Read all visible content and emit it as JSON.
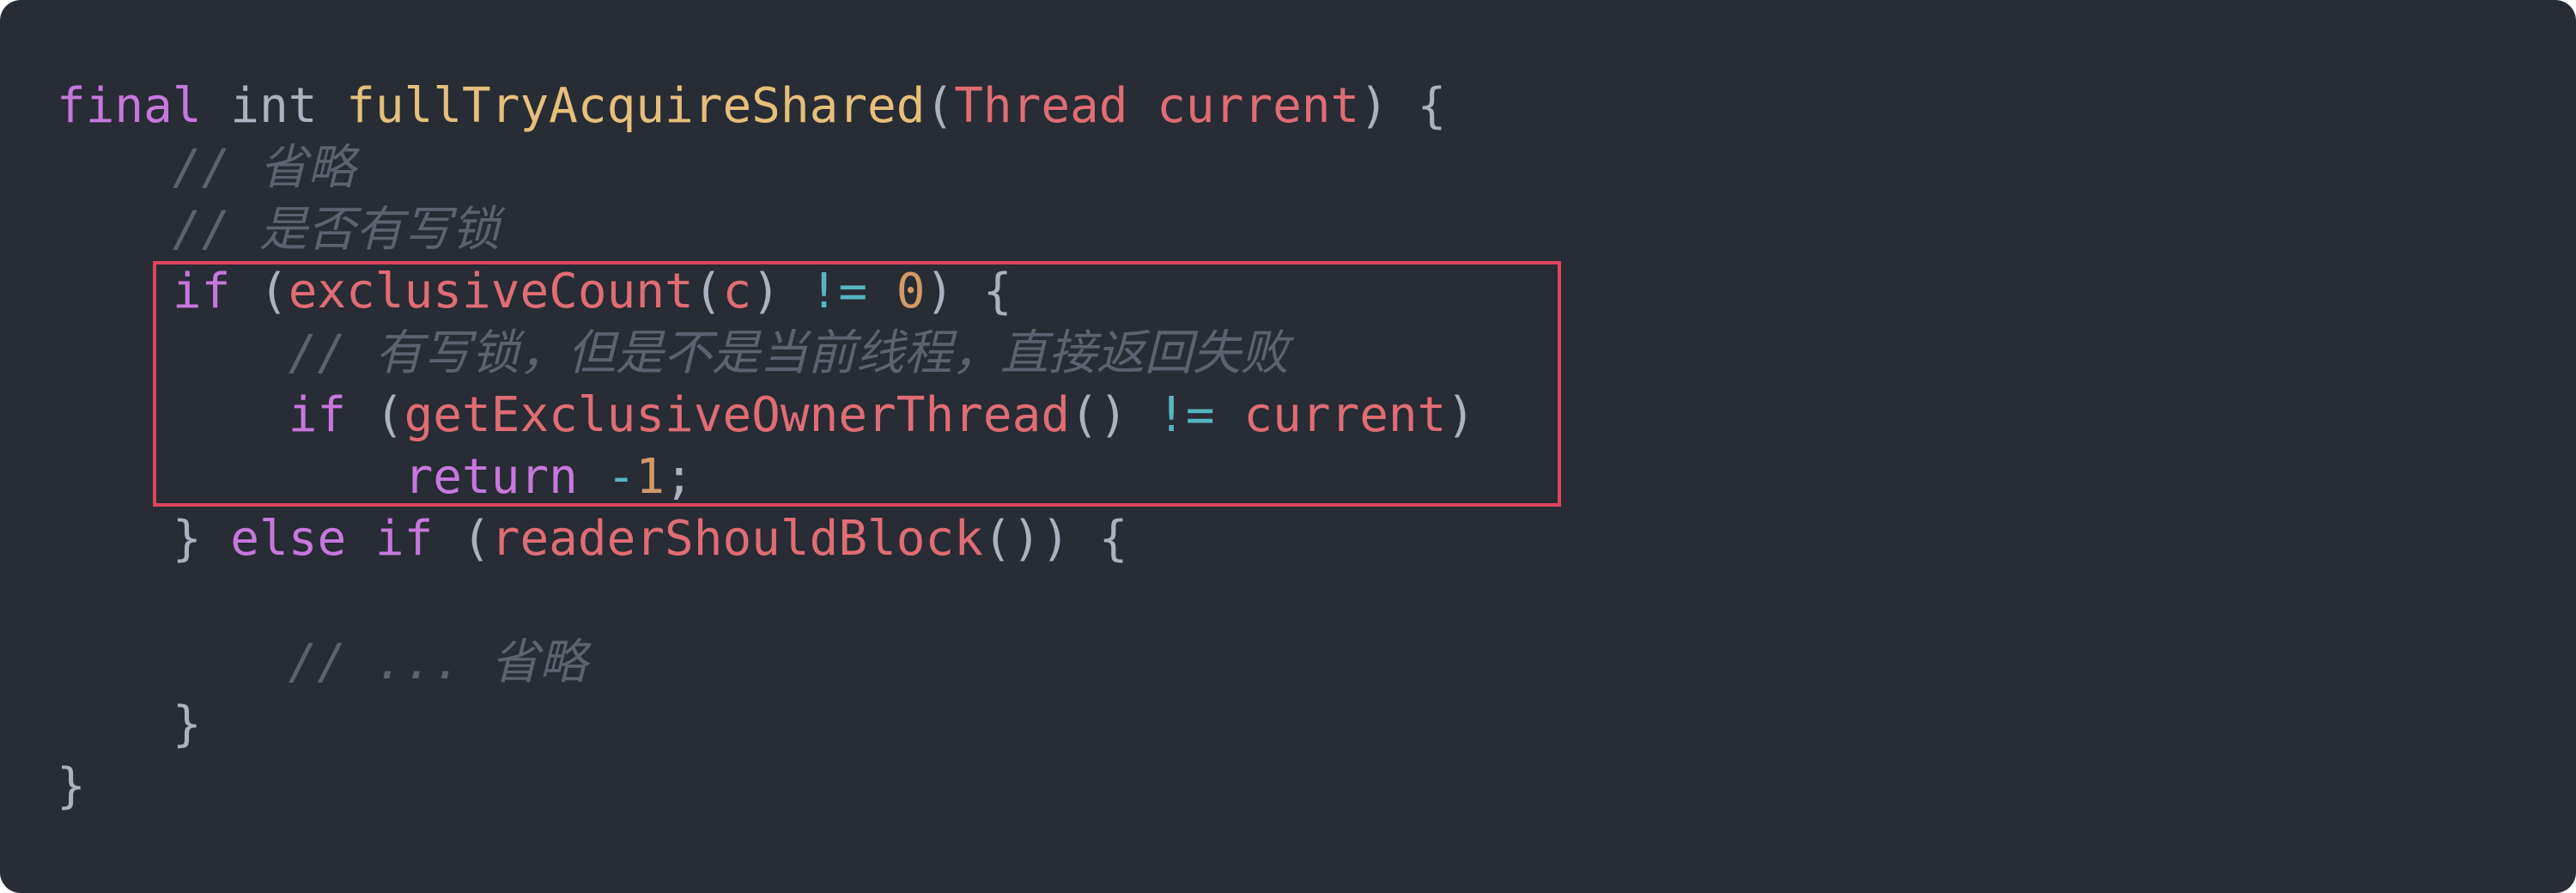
{
  "editor": {
    "background": "#282c34",
    "highlight_color": "#e0455f",
    "token_colors": {
      "keyword": "#c678dd",
      "type": "#abb2bf",
      "function_definition": "#e5c07b",
      "identifier": "#e06c75",
      "operator": "#56b6c2",
      "number": "#d19a66",
      "comment": "#5c6370",
      "punctuation": "#abb2bf"
    },
    "highlighted_lines": [
      3,
      4,
      5,
      6
    ],
    "lines": [
      {
        "tokens": [
          {
            "t": "final",
            "k": "keyword"
          },
          {
            "t": " ",
            "k": "space"
          },
          {
            "t": "int",
            "k": "type"
          },
          {
            "t": " ",
            "k": "space"
          },
          {
            "t": "fullTryAcquireShared",
            "k": "func-def"
          },
          {
            "t": "(",
            "k": "punc"
          },
          {
            "t": "Thread",
            "k": "class"
          },
          {
            "t": " ",
            "k": "space"
          },
          {
            "t": "current",
            "k": "param"
          },
          {
            "t": ") {",
            "k": "punc"
          }
        ]
      },
      {
        "tokens": [
          {
            "t": "    ",
            "k": "space"
          },
          {
            "t": "// 省略",
            "k": "comment"
          }
        ]
      },
      {
        "tokens": [
          {
            "t": "    ",
            "k": "space"
          },
          {
            "t": "// 是否有写锁",
            "k": "comment"
          }
        ]
      },
      {
        "tokens": [
          {
            "t": "    ",
            "k": "space"
          },
          {
            "t": "if",
            "k": "keyword"
          },
          {
            "t": " (",
            "k": "punc"
          },
          {
            "t": "exclusiveCount",
            "k": "call"
          },
          {
            "t": "(",
            "k": "punc"
          },
          {
            "t": "c",
            "k": "var"
          },
          {
            "t": ") ",
            "k": "punc"
          },
          {
            "t": "!=",
            "k": "op"
          },
          {
            "t": " ",
            "k": "space"
          },
          {
            "t": "0",
            "k": "number"
          },
          {
            "t": ") {",
            "k": "punc"
          }
        ]
      },
      {
        "tokens": [
          {
            "t": "        ",
            "k": "space"
          },
          {
            "t": "// 有写锁，但是不是当前线程，直接返回失败",
            "k": "comment"
          }
        ]
      },
      {
        "tokens": [
          {
            "t": "        ",
            "k": "space"
          },
          {
            "t": "if",
            "k": "keyword"
          },
          {
            "t": " (",
            "k": "punc"
          },
          {
            "t": "getExclusiveOwnerThread",
            "k": "call"
          },
          {
            "t": "() ",
            "k": "punc"
          },
          {
            "t": "!=",
            "k": "op"
          },
          {
            "t": " ",
            "k": "space"
          },
          {
            "t": "current",
            "k": "var"
          },
          {
            "t": ")",
            "k": "punc"
          }
        ]
      },
      {
        "tokens": [
          {
            "t": "            ",
            "k": "space"
          },
          {
            "t": "return",
            "k": "keyword"
          },
          {
            "t": " ",
            "k": "space"
          },
          {
            "t": "-",
            "k": "op"
          },
          {
            "t": "1",
            "k": "number"
          },
          {
            "t": ";",
            "k": "punc"
          }
        ]
      },
      {
        "tokens": [
          {
            "t": "    ",
            "k": "space"
          },
          {
            "t": "} ",
            "k": "punc"
          },
          {
            "t": "else",
            "k": "keyword"
          },
          {
            "t": " ",
            "k": "space"
          },
          {
            "t": "if",
            "k": "keyword"
          },
          {
            "t": " (",
            "k": "punc"
          },
          {
            "t": "readerShouldBlock",
            "k": "call"
          },
          {
            "t": "()) {",
            "k": "punc"
          }
        ]
      },
      {
        "tokens": []
      },
      {
        "tokens": [
          {
            "t": "        ",
            "k": "space"
          },
          {
            "t": "// ... 省略",
            "k": "comment"
          }
        ]
      },
      {
        "tokens": [
          {
            "t": "    ",
            "k": "space"
          },
          {
            "t": "}",
            "k": "punc"
          }
        ]
      },
      {
        "tokens": [
          {
            "t": "}",
            "k": "punc"
          }
        ]
      }
    ]
  }
}
